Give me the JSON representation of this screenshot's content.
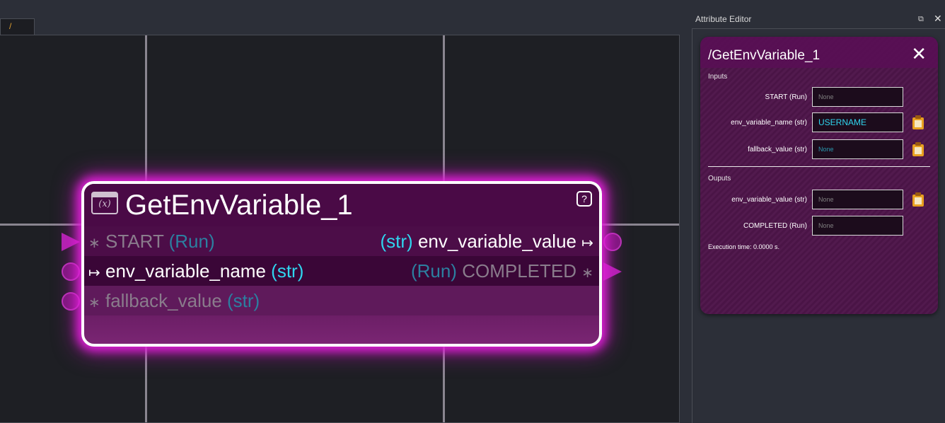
{
  "tab": {
    "label": "/"
  },
  "node": {
    "title": "GetEnvVariable_1",
    "icon_glyph": "(x)",
    "help_glyph": "?",
    "inputs": [
      {
        "symbol": "∗",
        "name": "START",
        "type": "(Run)"
      },
      {
        "symbol": "↦",
        "name": "env_variable_name",
        "type": "(str)"
      },
      {
        "symbol": "∗",
        "name": "fallback_value",
        "type": "(str)"
      }
    ],
    "outputs": [
      {
        "type": "(str)",
        "name": "env_variable_value",
        "symbol": "↦"
      },
      {
        "type": "(Run)",
        "name": "COMPLETED",
        "symbol": "∗"
      }
    ]
  },
  "attribute_editor": {
    "header": "Attribute Editor",
    "float_glyph": "⧉",
    "close_glyph": "✕",
    "title": "/GetEnvVariable_1",
    "close_card_glyph": "✕",
    "inputs_label": "Inputs",
    "outputs_label": "Ouputs",
    "inputs": [
      {
        "label": "START (Run)",
        "value": "None"
      },
      {
        "label": "env_variable_name (str)",
        "value": "USERNAME"
      },
      {
        "label": "fallback_value (str)",
        "value": "None"
      }
    ],
    "outputs": [
      {
        "label": "env_variable_value (str)",
        "value": "None"
      },
      {
        "label": "COMPLETED (Run)",
        "value": "None"
      }
    ],
    "execution_time": "Execution time: 0.0000 s."
  },
  "colors": {
    "node_glow": "#e020d8",
    "type_bright": "#2fd5ee",
    "clipboard": "#e8a020"
  },
  "icons": [
    "variable-icon",
    "help-icon",
    "clipboard-icon",
    "float-icon",
    "close-icon"
  ]
}
